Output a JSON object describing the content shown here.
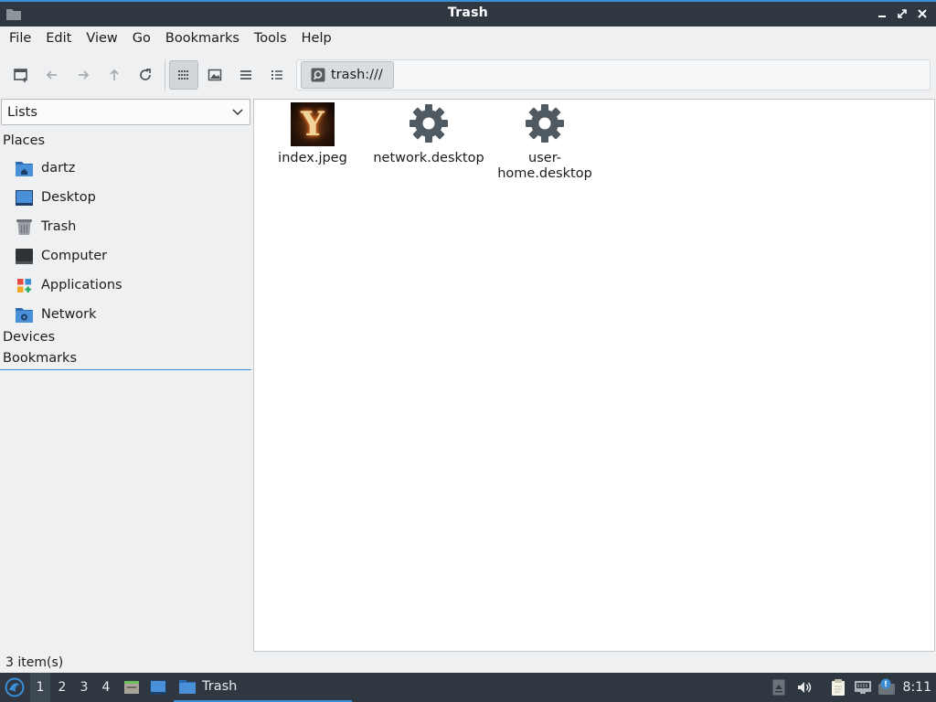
{
  "window": {
    "title": "Trash"
  },
  "menubar": {
    "items": [
      "File",
      "Edit",
      "View",
      "Go",
      "Bookmarks",
      "Tools",
      "Help"
    ]
  },
  "toolbar": {
    "buttons": [
      "new-tab-icon",
      "back-arrow-icon",
      "forward-arrow-icon",
      "up-arrow-icon",
      "reload-icon",
      "icon-view-icon",
      "thumbnail-view-icon",
      "compact-view-icon",
      "detailed-list-view-icon"
    ],
    "path": "trash:///"
  },
  "sidepane": {
    "mode": "Lists",
    "places_label": "Places",
    "places": [
      {
        "label": "dartz",
        "icon": "home-folder-icon"
      },
      {
        "label": "Desktop",
        "icon": "desktop-icon"
      },
      {
        "label": "Trash",
        "icon": "trash-icon"
      },
      {
        "label": "Computer",
        "icon": "computer-icon"
      },
      {
        "label": "Applications",
        "icon": "applications-icon"
      },
      {
        "label": "Network",
        "icon": "network-folder-icon"
      }
    ],
    "devices_label": "Devices",
    "bookmarks_label": "Bookmarks"
  },
  "files": [
    {
      "name": "index.jpeg",
      "icon": "image-thumbnail"
    },
    {
      "name": "network.desktop",
      "icon": "gear-icon"
    },
    {
      "name": "user-\nhome.desktop",
      "line1": "user-",
      "line2": "home.desktop",
      "icon": "gear-icon"
    }
  ],
  "status": {
    "text": "3 item(s)"
  },
  "taskbar": {
    "workspaces": [
      "1",
      "2",
      "3",
      "4"
    ],
    "active_workspace": "1",
    "window_label": "Trash",
    "clock": "8:11"
  },
  "colors": {
    "titlebar": "#2f3841",
    "accent": "#3b8ed6",
    "folder_blue": "#4a90d9"
  }
}
